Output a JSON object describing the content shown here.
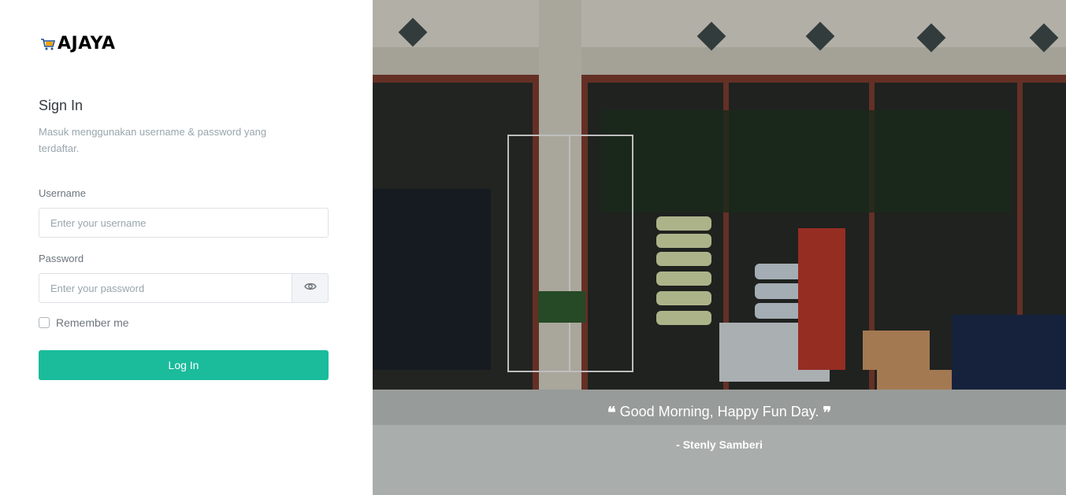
{
  "brand": {
    "name": "AJAYA",
    "icon": "shopping-cart-icon",
    "accent": "#1abc9c"
  },
  "auth": {
    "title": "Sign In",
    "subtitle": "Masuk menggunakan username & password yang terdaftar.",
    "username": {
      "label": "Username",
      "placeholder": "Enter your username",
      "value": ""
    },
    "password": {
      "label": "Password",
      "placeholder": "Enter your password",
      "value": "",
      "toggle_icon": "eye-icon"
    },
    "remember": {
      "label": "Remember me",
      "checked": false
    },
    "submit_label": "Log In"
  },
  "hero": {
    "quote": "Good Morning, Happy Fun Day.",
    "author": "- Stenly Samberi",
    "quote_icons": [
      "open-quote-icon",
      "close-quote-icon"
    ]
  }
}
